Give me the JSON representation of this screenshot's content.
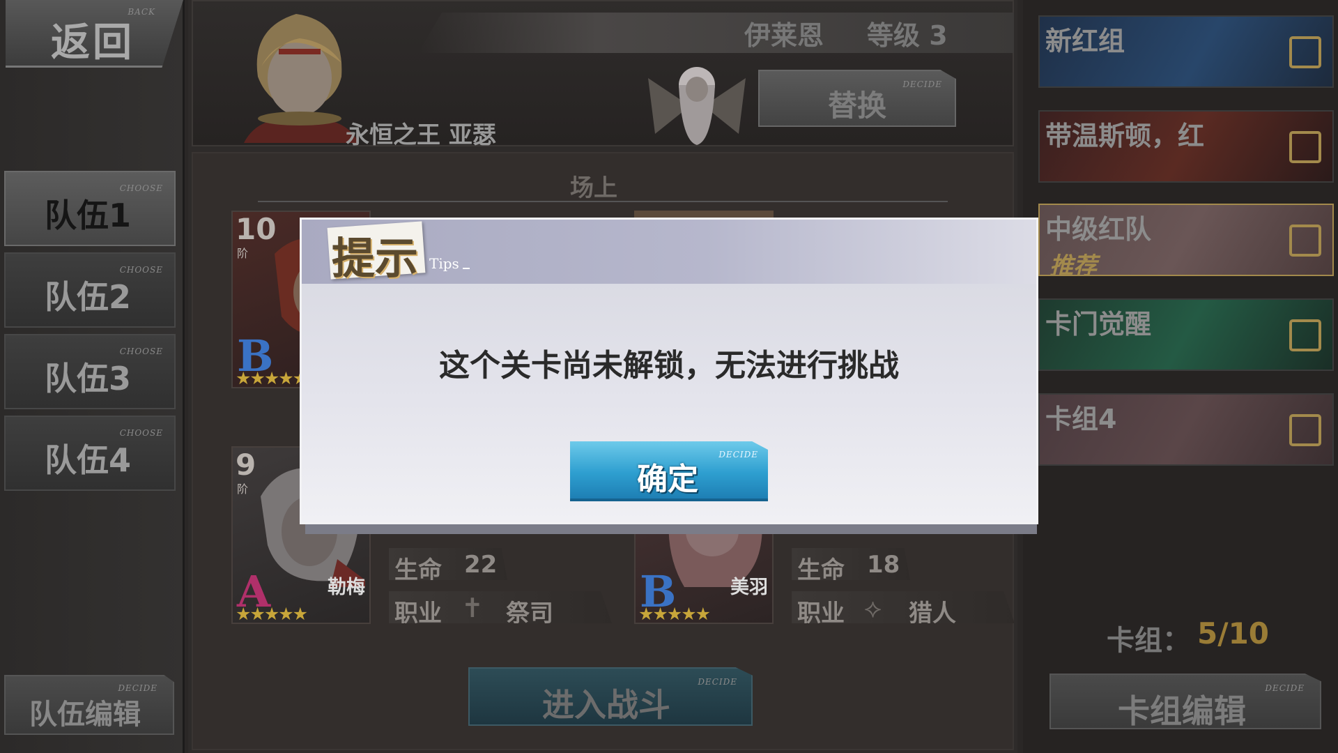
{
  "left": {
    "back_label": "返回",
    "back_tag": "BACK",
    "tabs": [
      {
        "label": "队伍1",
        "tag": "CHOOSE",
        "active": true
      },
      {
        "label": "队伍2",
        "tag": "CHOOSE",
        "active": false
      },
      {
        "label": "队伍3",
        "tag": "CHOOSE",
        "active": false
      },
      {
        "label": "队伍4",
        "tag": "CHOOSE",
        "active": false
      }
    ],
    "edit_team_label": "队伍编辑",
    "edit_team_tag": "DECIDE"
  },
  "leader": {
    "player_name": "伊莱恩",
    "player_level": "等级 3",
    "character_name": "永恒之王 亚瑟",
    "replace_label": "替换",
    "replace_tag": "DECIDE"
  },
  "field": {
    "title": "场上",
    "cards": [
      {
        "rank": "10",
        "rank_sub": "阶",
        "grade": "B",
        "stars": "★★★★★"
      },
      {
        "rank": "9",
        "rank_sub": "阶",
        "grade": "A",
        "stars": "★★★★★",
        "name": "勒梅",
        "stats": {
          "hp_key": "生命",
          "hp": "22",
          "job_key": "职业",
          "job": "祭司",
          "job_icon": "cross-icon"
        }
      },
      {
        "grade": "B",
        "stars": "★★★★★",
        "name": "美羽",
        "stats": {
          "hp_key": "生命",
          "hp": "18",
          "job_key": "职业",
          "job": "猎人",
          "job_icon": "bow-icon"
        }
      }
    ],
    "battle_label": "进入战斗",
    "battle_tag": "DECIDE"
  },
  "decks": {
    "items": [
      {
        "label": "新红组"
      },
      {
        "label": "带温斯顿，红"
      },
      {
        "label": "中级红队",
        "badge": "推荐",
        "selected": true
      },
      {
        "label": "卡门觉醒"
      },
      {
        "label": "卡组4"
      }
    ],
    "count_label": "卡组：",
    "count_value": "5/10",
    "edit_label": "卡组编辑",
    "edit_tag": "DECIDE"
  },
  "dialog": {
    "title": "提示",
    "subtitle": "Tips",
    "message": "这个关卡尚未解锁，无法进行挑战",
    "ok_label": "确定",
    "ok_tag": "DECIDE"
  },
  "colors": {
    "accent_gold": "#a38a4c",
    "ok_blue": "#2e9fd0",
    "grade_b": "#3a72c4",
    "grade_a": "#b0306a"
  }
}
